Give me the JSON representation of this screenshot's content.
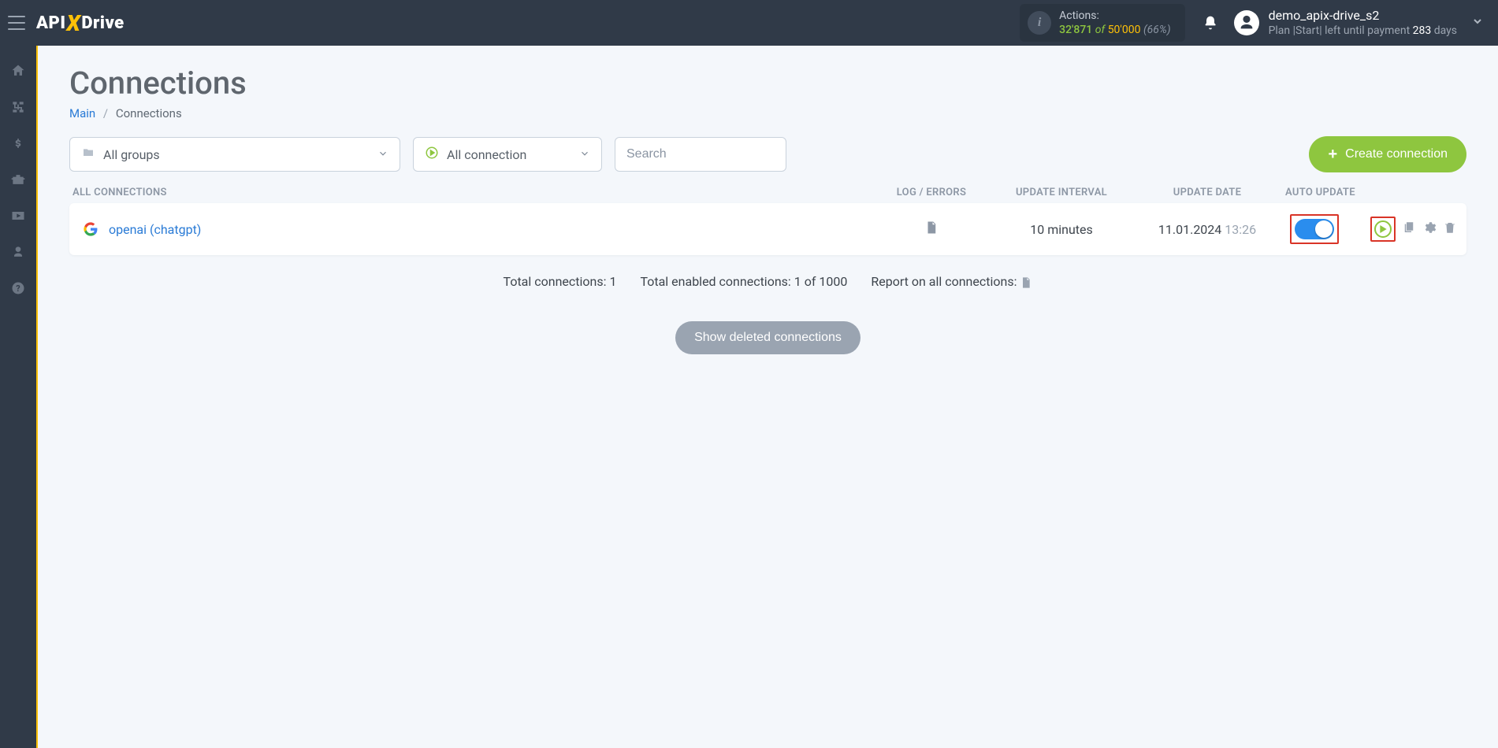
{
  "logo": {
    "part1": "API",
    "part2": "X",
    "part3": "Drive"
  },
  "actions": {
    "label": "Actions:",
    "used": "32'871",
    "of": "of",
    "total": "50'000",
    "pct": "(66%)"
  },
  "user": {
    "name": "demo_apix-drive_s2",
    "plan_prefix": "Plan |Start| left until payment ",
    "plan_days_num": "283",
    "plan_days_suffix": " days"
  },
  "page": {
    "title": "Connections",
    "breadcrumb_main": "Main",
    "breadcrumb_current": "Connections"
  },
  "filters": {
    "groups": "All groups",
    "status": "All connection",
    "search_placeholder": "Search",
    "create_btn": "Create connection"
  },
  "columns": {
    "name": "ALL CONNECTIONS",
    "log": "LOG / ERRORS",
    "interval": "UPDATE INTERVAL",
    "date": "UPDATE DATE",
    "auto": "AUTO UPDATE"
  },
  "rows": [
    {
      "name": "openai (chatgpt)",
      "interval": "10 minutes",
      "date": "11.01.2024",
      "time": "13:26",
      "auto_on": true
    }
  ],
  "summary": {
    "total_label": "Total connections: ",
    "total_value": "1",
    "enabled_label": "Total enabled connections: ",
    "enabled_value": "1 of 1000",
    "report_label": "Report on all connections: "
  },
  "show_deleted": "Show deleted connections"
}
